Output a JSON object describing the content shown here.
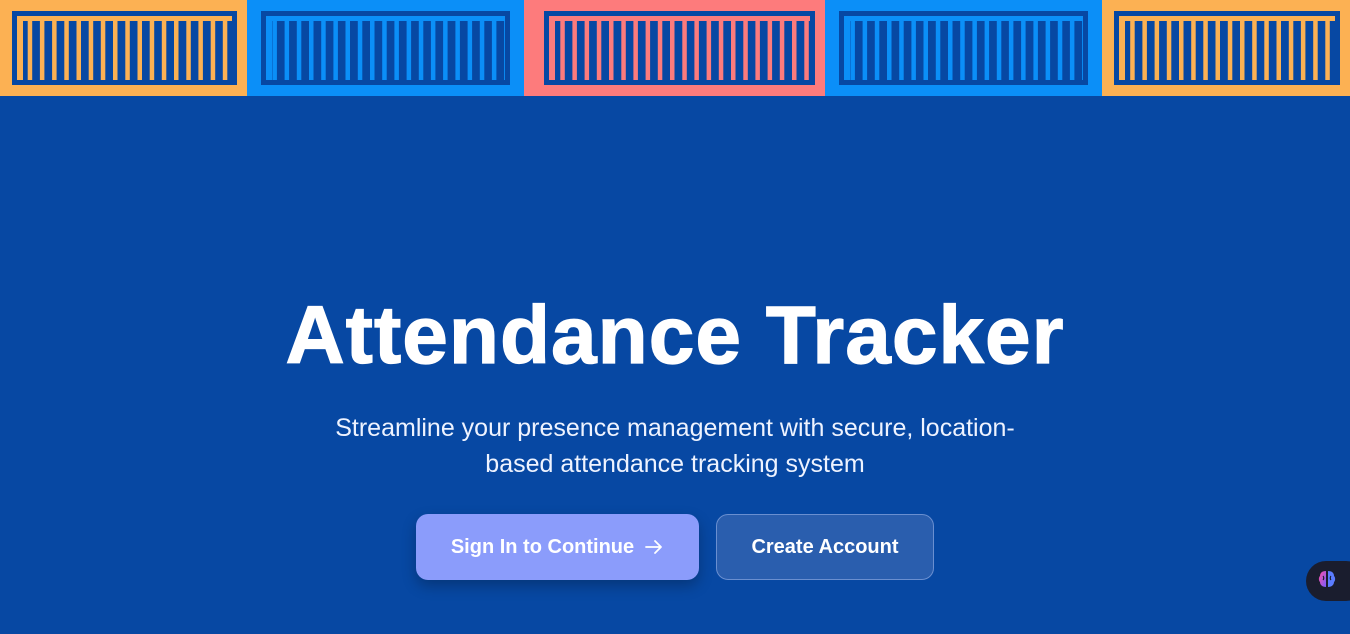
{
  "banner": {
    "panels": [
      {
        "name": "orange",
        "bg": "#fcb153",
        "stripe": "#fcb153"
      },
      {
        "name": "blue",
        "bg": "#0b8ff8",
        "stripe": "#0b8ff8"
      },
      {
        "name": "coral",
        "bg": "#fd7b7c",
        "stripe": "#fd7b7c"
      },
      {
        "name": "blue",
        "bg": "#0b8ff8",
        "stripe": "#0b8ff8"
      },
      {
        "name": "orange",
        "bg": "#fcb153",
        "stripe": "#fcb153"
      }
    ],
    "frame_color": "#0748a3"
  },
  "hero": {
    "title": "Attendance Tracker",
    "subtitle": "Streamline your presence management with secure, location-based attendance tracking system"
  },
  "actions": {
    "sign_in_label": "Sign In to Continue",
    "create_account_label": "Create Account"
  },
  "widget": {
    "icon": "brain-icon"
  },
  "colors": {
    "background": "#0748a3",
    "primary_button": "#8b9cfb",
    "secondary_button": "#2a5eae"
  }
}
